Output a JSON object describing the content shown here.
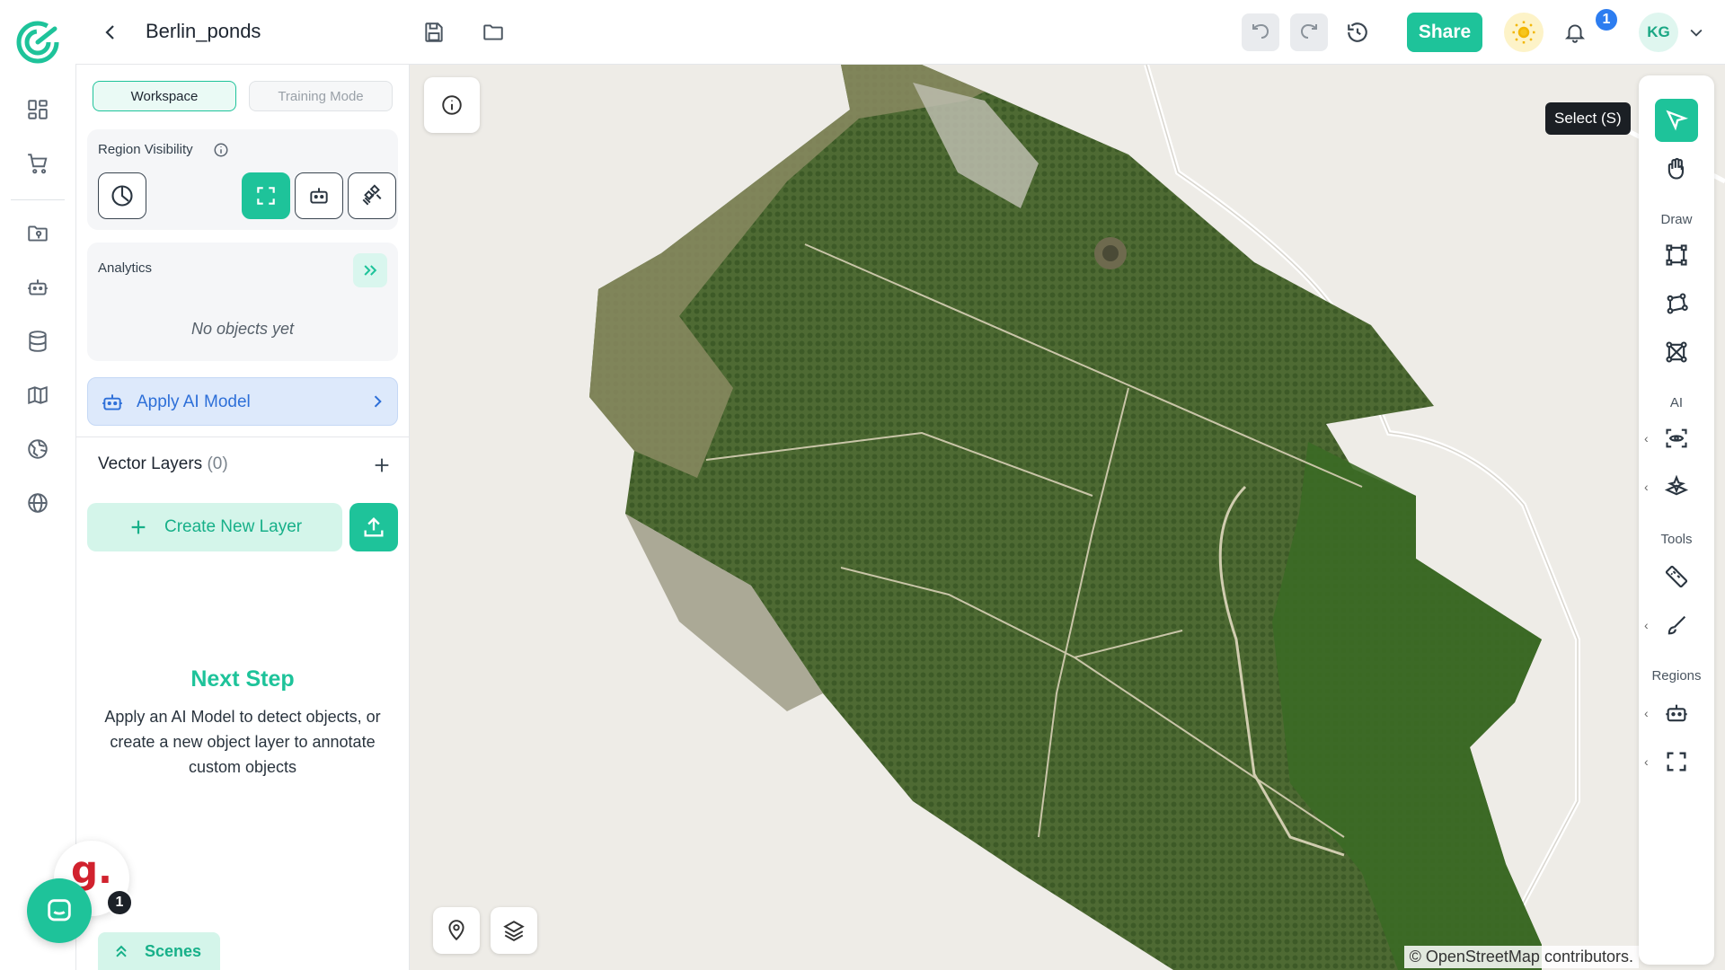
{
  "app": {
    "project_name": "Berlin_ponds"
  },
  "topbar": {
    "share_label": "Share",
    "notification_count": "1",
    "avatar_initials": "KG"
  },
  "panel": {
    "mode_tabs": {
      "workspace": "Workspace",
      "training": "Training Mode"
    },
    "region_visibility_label": "Region Visibility",
    "analytics_label": "Analytics",
    "analytics_empty": "No objects yet",
    "apply_ai_label": "Apply AI Model",
    "vector_layers_label": "Vector Layers",
    "vector_layers_count": "(0)",
    "create_layer_label": "Create New Layer",
    "next_step_title": "Next Step",
    "next_step_body": "Apply an AI Model to detect objects, or create a new object layer to annotate custom objects",
    "scenes_label": "Scenes"
  },
  "widgets": {
    "g_letter": "g.",
    "chat_badge": "1"
  },
  "toolbar": {
    "tooltip": "Select (S)",
    "sections": {
      "draw": "Draw",
      "ai": "AI",
      "tools": "Tools",
      "regions": "Regions"
    }
  },
  "map": {
    "attribution": "© OpenStreetMap contributors."
  },
  "colors": {
    "accent": "#1ec39a",
    "ai_blue": "#2d6fd8",
    "map_bg": "#eeece7"
  }
}
